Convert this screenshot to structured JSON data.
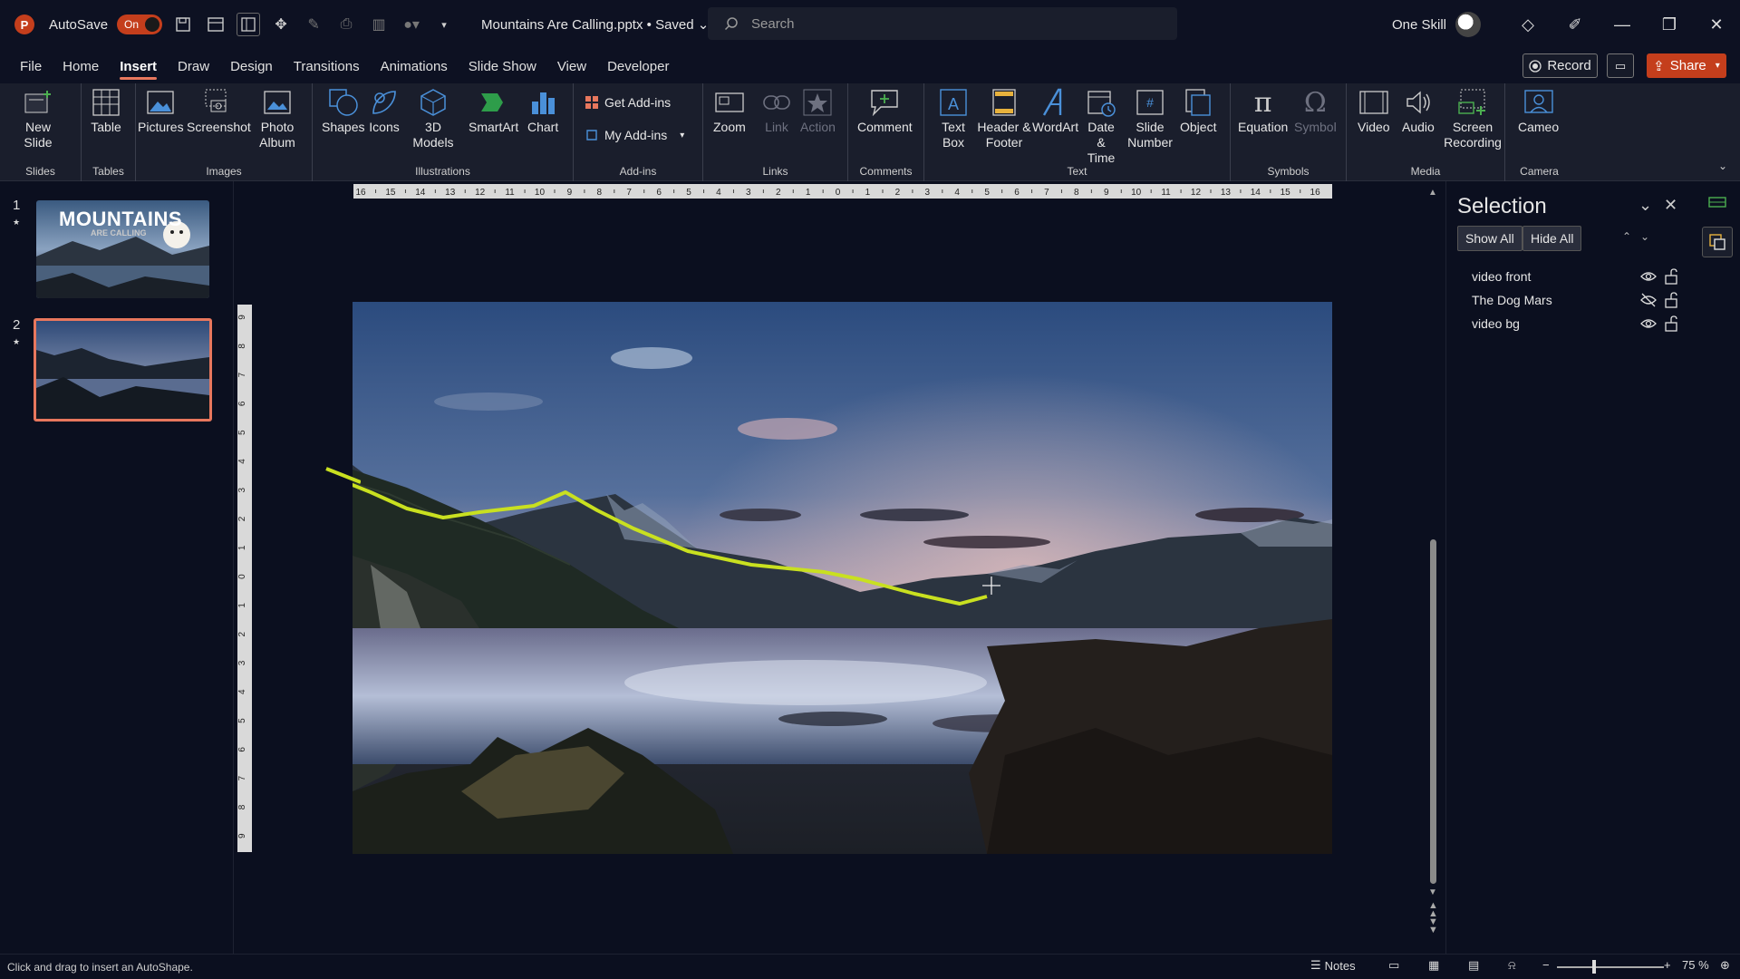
{
  "app": {
    "autosave_label": "AutoSave",
    "autosave_state": "On",
    "doc_title": "Mountains Are Calling.pptx • Saved",
    "search_placeholder": "Search",
    "user_name": "One Skill",
    "accent": "#c43e1c"
  },
  "menu": {
    "tabs": [
      "File",
      "Home",
      "Insert",
      "Draw",
      "Design",
      "Transitions",
      "Animations",
      "Slide Show",
      "View",
      "Developer"
    ],
    "active": "Insert",
    "record_label": "Record",
    "share_label": "Share"
  },
  "ribbon": {
    "slides": {
      "label": "Slides",
      "new_slide": "New Slide"
    },
    "tables": {
      "label": "Tables",
      "table": "Table"
    },
    "images": {
      "label": "Images",
      "pictures": "Pictures",
      "screenshot": "Screenshot",
      "photo_album": "Photo Album"
    },
    "illustrations": {
      "label": "Illustrations",
      "shapes": "Shapes",
      "icons": "Icons",
      "models": "3D Models",
      "smartart": "SmartArt",
      "chart": "Chart"
    },
    "addins": {
      "label": "Add-ins",
      "get": "Get Add-ins",
      "my": "My Add-ins"
    },
    "links": {
      "label": "Links",
      "zoom": "Zoom",
      "link": "Link",
      "action": "Action"
    },
    "comments": {
      "label": "Comments",
      "comment": "Comment"
    },
    "text": {
      "label": "Text",
      "textbox": "Text Box",
      "header": "Header & Footer",
      "wordart": "WordArt",
      "datetime": "Date & Time",
      "slidenum": "Slide Number",
      "object": "Object"
    },
    "symbols": {
      "label": "Symbols",
      "equation": "Equation",
      "symbol": "Symbol"
    },
    "media": {
      "label": "Media",
      "video": "Video",
      "audio": "Audio",
      "screenrec": "Screen Recording"
    },
    "camera": {
      "label": "Camera",
      "cameo": "Cameo"
    }
  },
  "thumbnails": {
    "items": [
      {
        "num": "1",
        "title": "MOUNTAINS",
        "subtitle": "ARE CALLING"
      },
      {
        "num": "2"
      }
    ]
  },
  "ruler": {
    "h_ticks": [
      "16",
      "15",
      "14",
      "13",
      "12",
      "11",
      "10",
      "9",
      "8",
      "7",
      "6",
      "5",
      "4",
      "3",
      "2",
      "1",
      "0",
      "1",
      "2",
      "3",
      "4",
      "5",
      "6",
      "7",
      "8",
      "9",
      "10",
      "11",
      "12",
      "13",
      "14",
      "15",
      "16"
    ],
    "v_ticks": [
      "9",
      "8",
      "7",
      "6",
      "5",
      "4",
      "3",
      "2",
      "1",
      "0",
      "1",
      "2",
      "3",
      "4",
      "5",
      "6",
      "7",
      "8",
      "9"
    ]
  },
  "selection": {
    "title": "Selection",
    "show_all": "Show All",
    "hide_all": "Hide All",
    "items": [
      {
        "name": "video front",
        "visible": true
      },
      {
        "name": "The Dog Mars",
        "visible": false
      },
      {
        "name": "video bg",
        "visible": true
      }
    ]
  },
  "status": {
    "message": "Click and drag to insert an AutoShape.",
    "notes": "Notes",
    "zoom": "75 %"
  }
}
